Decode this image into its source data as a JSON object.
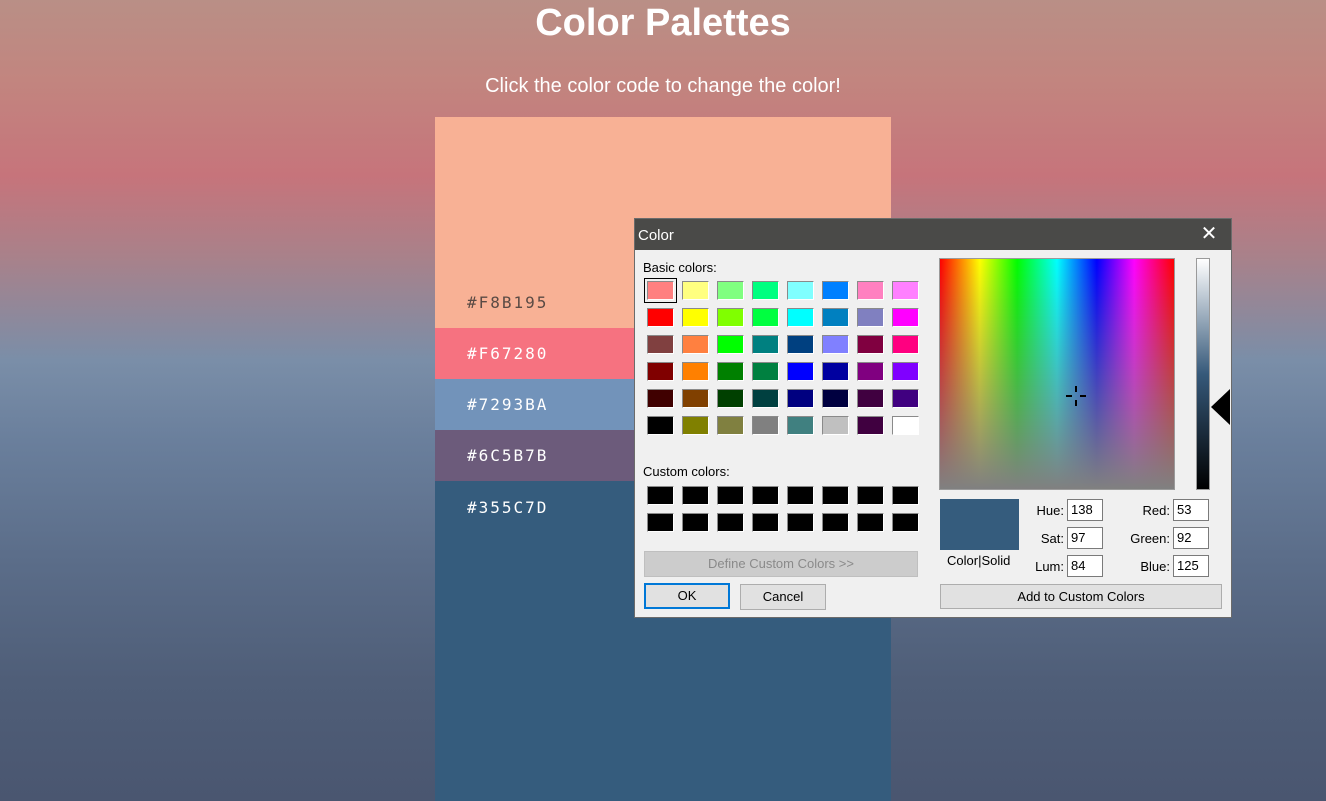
{
  "page": {
    "title": "Color Palettes",
    "subtitle": "Click the color code to change the color!"
  },
  "palette": [
    {
      "code": "#F8B195",
      "color": "#F8B195"
    },
    {
      "code": "#F67280",
      "color": "#F67280"
    },
    {
      "code": "#7293BA",
      "color": "#7293BA"
    },
    {
      "code": "#6C5B7B",
      "color": "#6C5B7B"
    },
    {
      "code": "#355C7D",
      "color": "#355C7D"
    }
  ],
  "dialog": {
    "title": "Color",
    "close_glyph": "✕",
    "basic_colors_label": "Basic colors:",
    "custom_colors_label": "Custom colors:",
    "basic_colors": [
      "#ff8080",
      "#ffff80",
      "#80ff80",
      "#00ff80",
      "#80ffff",
      "#0080ff",
      "#ff80c0",
      "#ff80ff",
      "#ff0000",
      "#ffff00",
      "#80ff00",
      "#00ff40",
      "#00ffff",
      "#0080c0",
      "#8080c0",
      "#ff00ff",
      "#804040",
      "#ff8040",
      "#00ff00",
      "#008080",
      "#004080",
      "#8080ff",
      "#800040",
      "#ff0080",
      "#800000",
      "#ff8000",
      "#008000",
      "#008040",
      "#0000ff",
      "#0000a0",
      "#800080",
      "#8000ff",
      "#400000",
      "#804000",
      "#004000",
      "#004040",
      "#000080",
      "#000040",
      "#400040",
      "#400080",
      "#000000",
      "#808000",
      "#808040",
      "#808080",
      "#408080",
      "#c0c0c0",
      "#400040",
      "#ffffff"
    ],
    "custom_colors": [
      "#000000",
      "#000000",
      "#000000",
      "#000000",
      "#000000",
      "#000000",
      "#000000",
      "#000000",
      "#000000",
      "#000000",
      "#000000",
      "#000000",
      "#000000",
      "#000000",
      "#000000",
      "#000000"
    ],
    "define_custom_label": "Define Custom Colors >>",
    "ok_label": "OK",
    "cancel_label": "Cancel",
    "preview_color": "#355C7D",
    "preview_label": "Color|Solid",
    "hue_label": "Hue:",
    "sat_label": "Sat:",
    "lum_label": "Lum:",
    "red_label": "Red:",
    "green_label": "Green:",
    "blue_label": "Blue:",
    "hue": "138",
    "sat": "97",
    "lum": "84",
    "red": "53",
    "green": "92",
    "blue": "125",
    "add_custom_label": "Add to Custom Colors"
  }
}
